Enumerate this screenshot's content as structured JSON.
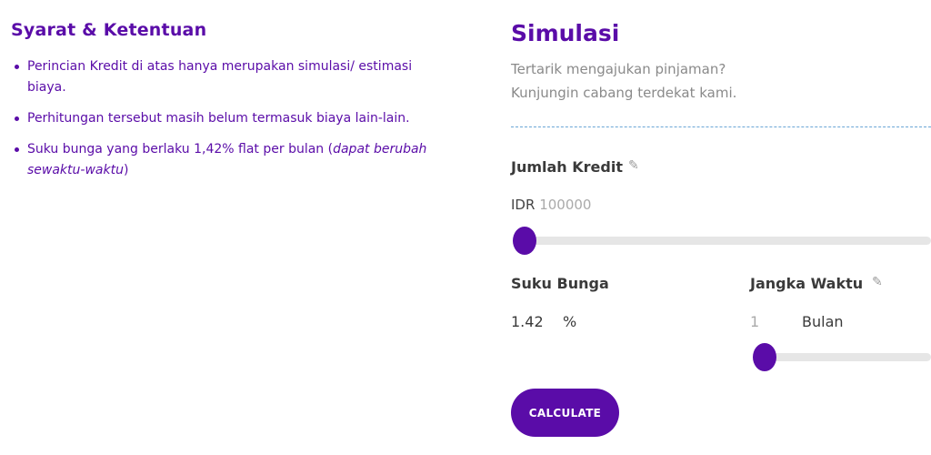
{
  "terms": {
    "title": "Syarat & Ketentuan",
    "item1": "Perincian Kredit di atas hanya merupakan simulasi/ estimasi biaya.",
    "item2": "Perhitungan tersebut masih belum termasuk biaya lain-lain.",
    "item3_prefix": "Suku bunga yang berlaku 1,42% flat per bulan (",
    "item3_italic": "dapat berubah sewaktu-waktu",
    "item3_suffix": ")"
  },
  "simulasi": {
    "title": "Simulasi",
    "subtitle_line1": "Tertarik mengajukan pinjaman?",
    "subtitle_line2": "Kunjungin cabang terdekat kami.",
    "jumlah_label": "Jumlah Kredit",
    "currency": "IDR",
    "jumlah_value": "100000",
    "jumlah_slider_fraction": 0,
    "suku_label": "Suku Bunga",
    "suku_value": "1.42",
    "suku_unit": "%",
    "jangka_label": "Jangka Waktu",
    "jangka_value": "1",
    "jangka_unit": "Bulan",
    "jangka_slider_fraction": 0,
    "calculate_label": "CALCULATE"
  },
  "icons": {
    "edit": "pencil-icon"
  },
  "colors": {
    "accent": "#5a0ca8",
    "divider": "#6aa6d6"
  }
}
